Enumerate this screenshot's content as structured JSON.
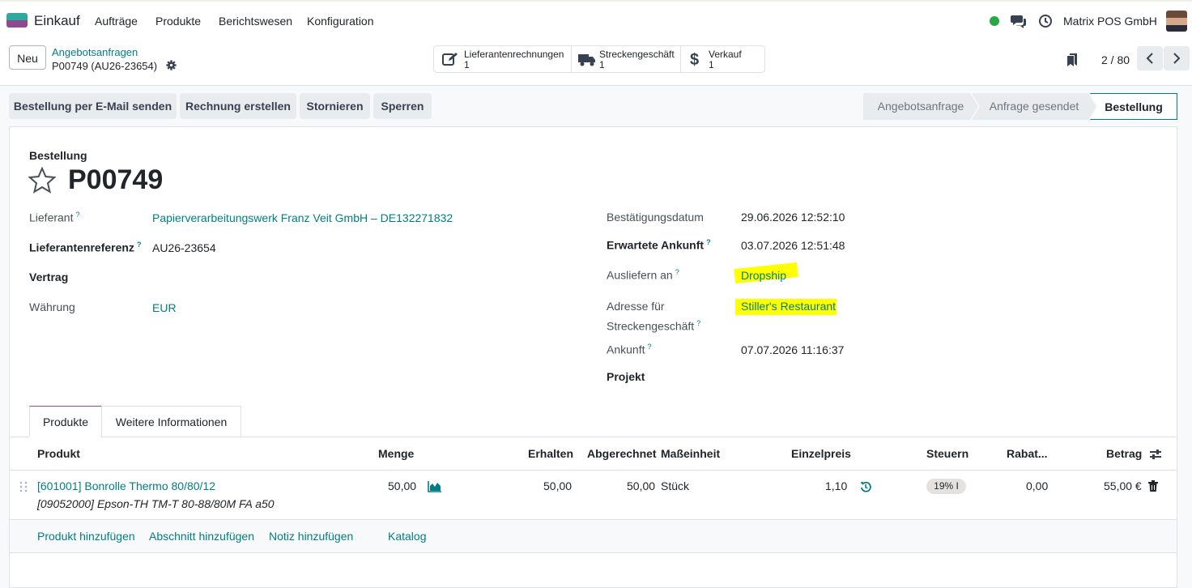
{
  "navbar": {
    "app_name": "Einkauf",
    "menu": [
      "Aufträge",
      "Produkte",
      "Berichtswesen",
      "Konfiguration"
    ],
    "company": "Matrix POS GmbH"
  },
  "control_panel": {
    "new_label": "Neu",
    "breadcrumb_parent": "Angebotsanfragen",
    "breadcrumb_current": "P00749 (AU26-23654)",
    "smart_buttons": [
      {
        "label": "Lieferantenrechnungen",
        "count": "1",
        "icon": "edit-icon"
      },
      {
        "label": "Streckengeschäft",
        "count": "1",
        "icon": "truck-icon"
      },
      {
        "label": "Verkauf",
        "count": "1",
        "icon": "dollar-icon"
      }
    ],
    "pager": "2 / 80"
  },
  "statusbar": {
    "actions": [
      "Bestellung per E-Mail senden",
      "Rechnung erstellen",
      "Stornieren",
      "Sperren"
    ],
    "stages": [
      "Angebotsanfrage",
      "Anfrage gesendet",
      "Bestellung"
    ],
    "active_stage": "Bestellung"
  },
  "form": {
    "doc_type": "Bestellung",
    "name": "P00749",
    "left": {
      "supplier_label": "Lieferant",
      "supplier_value": "Papierverarbeitungswerk Franz Veit GmbH – DE132271832",
      "ref_label": "Lieferantenreferenz",
      "ref_value": "AU26-23654",
      "contract_label": "Vertrag",
      "currency_label": "Währung",
      "currency_value": "EUR"
    },
    "right": {
      "confirm_label": "Bestätigungsdatum",
      "confirm_value": "29.06.2026 12:52:10",
      "expected_label": "Erwartete Ankunft",
      "expected_value": "03.07.2026 12:51:48",
      "deliver_label": "Ausliefern an",
      "deliver_value": "Dropship",
      "dropship_label_1": "Adresse für",
      "dropship_label_2": "Streckengeschäft",
      "dropship_value": "Stiller's Restaurant",
      "arrival_label": "Ankunft",
      "arrival_value": "07.07.2026 11:16:37",
      "project_label": "Projekt"
    },
    "help_mark": "?"
  },
  "tabs": [
    "Produkte",
    "Weitere Informationen"
  ],
  "lines": {
    "headers": [
      "Produkt",
      "Menge",
      "Erhalten",
      "Abgerechnet",
      "Maßeinheit",
      "Einzelpreis",
      "Steuern",
      "Rabat...",
      "Betrag"
    ],
    "rows": [
      {
        "product": "[601001] Bonrolle Thermo 80/80/12",
        "description": "[09052000] Epson-TH TM-T 80-88/80M FA a50",
        "qty": "50,00",
        "received": "50,00",
        "invoiced": "50,00",
        "uom": "Stück",
        "price": "1,10",
        "tax": "19% I",
        "discount": "0,00",
        "amount": "55,00 €"
      }
    ],
    "add_links": [
      "Produkt hinzufügen",
      "Abschnitt hinzufügen",
      "Notiz hinzufügen",
      "Katalog"
    ]
  }
}
